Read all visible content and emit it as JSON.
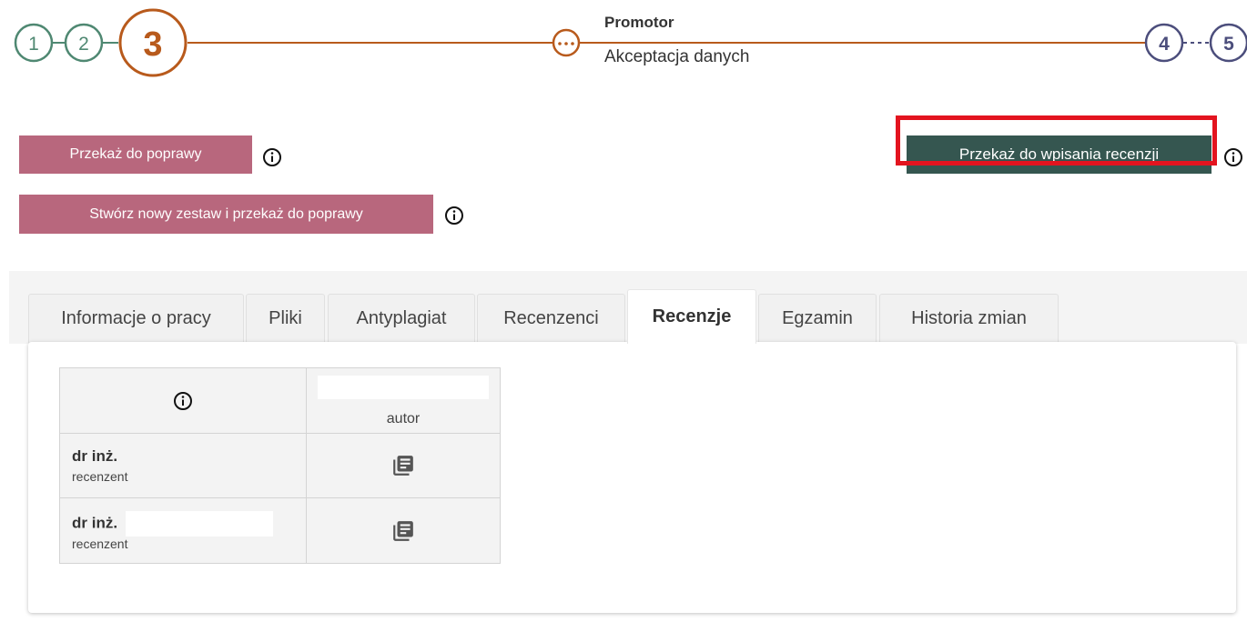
{
  "stepper": {
    "steps": [
      "1",
      "2",
      "3",
      "4",
      "5"
    ],
    "current_title": "Promotor",
    "current_subtitle": "Akceptacja danych",
    "colors": {
      "done": "#4f8872",
      "current": "#b85a1c",
      "todo": "#4c4e7c"
    }
  },
  "actions": {
    "return_label": "Przekaż do poprawy",
    "new_set_label": "Stwórz nowy zestaw i przekaż do poprawy",
    "review_label": "Przekaż do wpisania recenzji"
  },
  "tabs": [
    {
      "label": "Informacje o pracy",
      "active": false
    },
    {
      "label": "Pliki",
      "active": false
    },
    {
      "label": "Antyplagiat",
      "active": false
    },
    {
      "label": "Recenzenci",
      "active": false
    },
    {
      "label": "Recenzje",
      "active": true
    },
    {
      "label": "Egzamin",
      "active": false
    },
    {
      "label": "Historia zmian",
      "active": false
    }
  ],
  "reviews_table": {
    "header_col2_role": "autor",
    "rows": [
      {
        "title": "dr inż.",
        "role": "recenzent",
        "icon": "review-document-icon"
      },
      {
        "title": "dr inż.",
        "role": "recenzent",
        "icon": "review-document-icon"
      }
    ]
  }
}
